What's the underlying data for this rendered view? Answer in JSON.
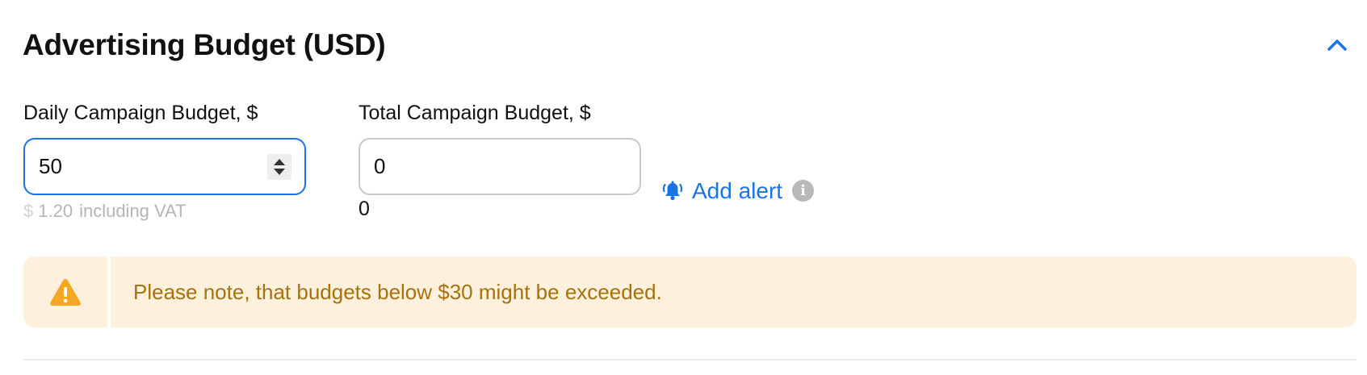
{
  "section": {
    "title": "Advertising Budget (USD)",
    "collapse_icon": "chevron-up-icon"
  },
  "daily_budget": {
    "label": "Daily Campaign Budget, $",
    "value": "50",
    "stepper_icon": "stepper-arrows-icon",
    "vat_currency": "$",
    "vat_amount": "1.20",
    "vat_suffix": "including VAT"
  },
  "total_budget": {
    "label": "Total Campaign Budget, $",
    "value": "0",
    "echo_value": "0"
  },
  "alert": {
    "label": "Add alert",
    "icon": "bell-icon",
    "info_icon": "info-icon"
  },
  "notice": {
    "icon": "warning-icon",
    "text": "Please note, that budgets below $30 might be exceeded."
  },
  "colors": {
    "accent": "#1a73e8",
    "warning_bg": "#fdf1de",
    "warning_text": "#a8720a",
    "warning_icon": "#f5a623",
    "muted_text": "#b5b5b5"
  }
}
